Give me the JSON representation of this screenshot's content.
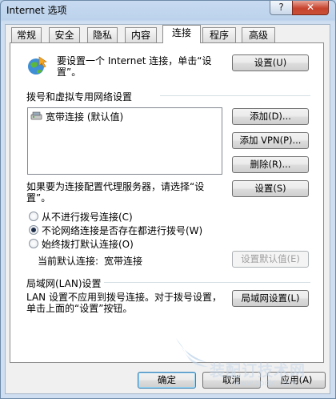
{
  "window": {
    "title": "Internet 选项",
    "help_btn": "?",
    "close_btn": "✕"
  },
  "tabs": [
    "常规",
    "安全",
    "隐私",
    "内容",
    "连接",
    "程序",
    "高级"
  ],
  "active_tab": "连接",
  "setup": {
    "text": "要设置一个 Internet 连接，单击“设置”。",
    "button": "设置(U)"
  },
  "dialup": {
    "group_label": "拨号和虚拟专用网络设置",
    "items": [
      "宽带连接 (默认值)"
    ],
    "add_button": "添加(D)...",
    "add_vpn_button": "添加 VPN(P)...",
    "remove_button": "删除(R)...",
    "proxy_text": "如果要为连接配置代理服务器，请选择“设置”。",
    "settings_button": "设置(S)",
    "radio_options": [
      "从不进行拨号连接(C)",
      "不论网络连接是否存在都进行拨号(W)",
      "始终拨打默认连接(O)"
    ],
    "selected_radio": 1,
    "current_default_label": "当前默认连接:",
    "current_default_value": "宽带连接",
    "set_default_button": "设置默认值(E)"
  },
  "lan": {
    "group_label": "局域网(LAN)设置",
    "text": "LAN 设置不应用到拨号连接。对于拨号设置，单击上面的“设置”按钮。",
    "button": "局域网设置(L)"
  },
  "footer": {
    "ok": "确定",
    "cancel": "取消",
    "apply": "应用(A)"
  },
  "watermark": {
    "text": "装配订技术网",
    "url": "www.zpdjc.com"
  }
}
